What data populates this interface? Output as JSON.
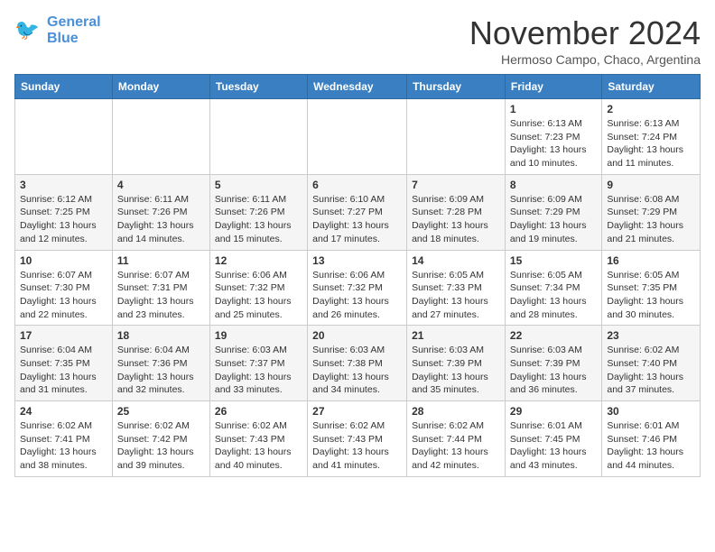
{
  "logo": {
    "line1": "General",
    "line2": "Blue"
  },
  "header": {
    "month": "November 2024",
    "location": "Hermoso Campo, Chaco, Argentina"
  },
  "weekdays": [
    "Sunday",
    "Monday",
    "Tuesday",
    "Wednesday",
    "Thursday",
    "Friday",
    "Saturday"
  ],
  "weeks": [
    [
      {
        "day": "",
        "info": ""
      },
      {
        "day": "",
        "info": ""
      },
      {
        "day": "",
        "info": ""
      },
      {
        "day": "",
        "info": ""
      },
      {
        "day": "",
        "info": ""
      },
      {
        "day": "1",
        "info": "Sunrise: 6:13 AM\nSunset: 7:23 PM\nDaylight: 13 hours and 10 minutes."
      },
      {
        "day": "2",
        "info": "Sunrise: 6:13 AM\nSunset: 7:24 PM\nDaylight: 13 hours and 11 minutes."
      }
    ],
    [
      {
        "day": "3",
        "info": "Sunrise: 6:12 AM\nSunset: 7:25 PM\nDaylight: 13 hours and 12 minutes."
      },
      {
        "day": "4",
        "info": "Sunrise: 6:11 AM\nSunset: 7:26 PM\nDaylight: 13 hours and 14 minutes."
      },
      {
        "day": "5",
        "info": "Sunrise: 6:11 AM\nSunset: 7:26 PM\nDaylight: 13 hours and 15 minutes."
      },
      {
        "day": "6",
        "info": "Sunrise: 6:10 AM\nSunset: 7:27 PM\nDaylight: 13 hours and 17 minutes."
      },
      {
        "day": "7",
        "info": "Sunrise: 6:09 AM\nSunset: 7:28 PM\nDaylight: 13 hours and 18 minutes."
      },
      {
        "day": "8",
        "info": "Sunrise: 6:09 AM\nSunset: 7:29 PM\nDaylight: 13 hours and 19 minutes."
      },
      {
        "day": "9",
        "info": "Sunrise: 6:08 AM\nSunset: 7:29 PM\nDaylight: 13 hours and 21 minutes."
      }
    ],
    [
      {
        "day": "10",
        "info": "Sunrise: 6:07 AM\nSunset: 7:30 PM\nDaylight: 13 hours and 22 minutes."
      },
      {
        "day": "11",
        "info": "Sunrise: 6:07 AM\nSunset: 7:31 PM\nDaylight: 13 hours and 23 minutes."
      },
      {
        "day": "12",
        "info": "Sunrise: 6:06 AM\nSunset: 7:32 PM\nDaylight: 13 hours and 25 minutes."
      },
      {
        "day": "13",
        "info": "Sunrise: 6:06 AM\nSunset: 7:32 PM\nDaylight: 13 hours and 26 minutes."
      },
      {
        "day": "14",
        "info": "Sunrise: 6:05 AM\nSunset: 7:33 PM\nDaylight: 13 hours and 27 minutes."
      },
      {
        "day": "15",
        "info": "Sunrise: 6:05 AM\nSunset: 7:34 PM\nDaylight: 13 hours and 28 minutes."
      },
      {
        "day": "16",
        "info": "Sunrise: 6:05 AM\nSunset: 7:35 PM\nDaylight: 13 hours and 30 minutes."
      }
    ],
    [
      {
        "day": "17",
        "info": "Sunrise: 6:04 AM\nSunset: 7:35 PM\nDaylight: 13 hours and 31 minutes."
      },
      {
        "day": "18",
        "info": "Sunrise: 6:04 AM\nSunset: 7:36 PM\nDaylight: 13 hours and 32 minutes."
      },
      {
        "day": "19",
        "info": "Sunrise: 6:03 AM\nSunset: 7:37 PM\nDaylight: 13 hours and 33 minutes."
      },
      {
        "day": "20",
        "info": "Sunrise: 6:03 AM\nSunset: 7:38 PM\nDaylight: 13 hours and 34 minutes."
      },
      {
        "day": "21",
        "info": "Sunrise: 6:03 AM\nSunset: 7:39 PM\nDaylight: 13 hours and 35 minutes."
      },
      {
        "day": "22",
        "info": "Sunrise: 6:03 AM\nSunset: 7:39 PM\nDaylight: 13 hours and 36 minutes."
      },
      {
        "day": "23",
        "info": "Sunrise: 6:02 AM\nSunset: 7:40 PM\nDaylight: 13 hours and 37 minutes."
      }
    ],
    [
      {
        "day": "24",
        "info": "Sunrise: 6:02 AM\nSunset: 7:41 PM\nDaylight: 13 hours and 38 minutes."
      },
      {
        "day": "25",
        "info": "Sunrise: 6:02 AM\nSunset: 7:42 PM\nDaylight: 13 hours and 39 minutes."
      },
      {
        "day": "26",
        "info": "Sunrise: 6:02 AM\nSunset: 7:43 PM\nDaylight: 13 hours and 40 minutes."
      },
      {
        "day": "27",
        "info": "Sunrise: 6:02 AM\nSunset: 7:43 PM\nDaylight: 13 hours and 41 minutes."
      },
      {
        "day": "28",
        "info": "Sunrise: 6:02 AM\nSunset: 7:44 PM\nDaylight: 13 hours and 42 minutes."
      },
      {
        "day": "29",
        "info": "Sunrise: 6:01 AM\nSunset: 7:45 PM\nDaylight: 13 hours and 43 minutes."
      },
      {
        "day": "30",
        "info": "Sunrise: 6:01 AM\nSunset: 7:46 PM\nDaylight: 13 hours and 44 minutes."
      }
    ]
  ]
}
